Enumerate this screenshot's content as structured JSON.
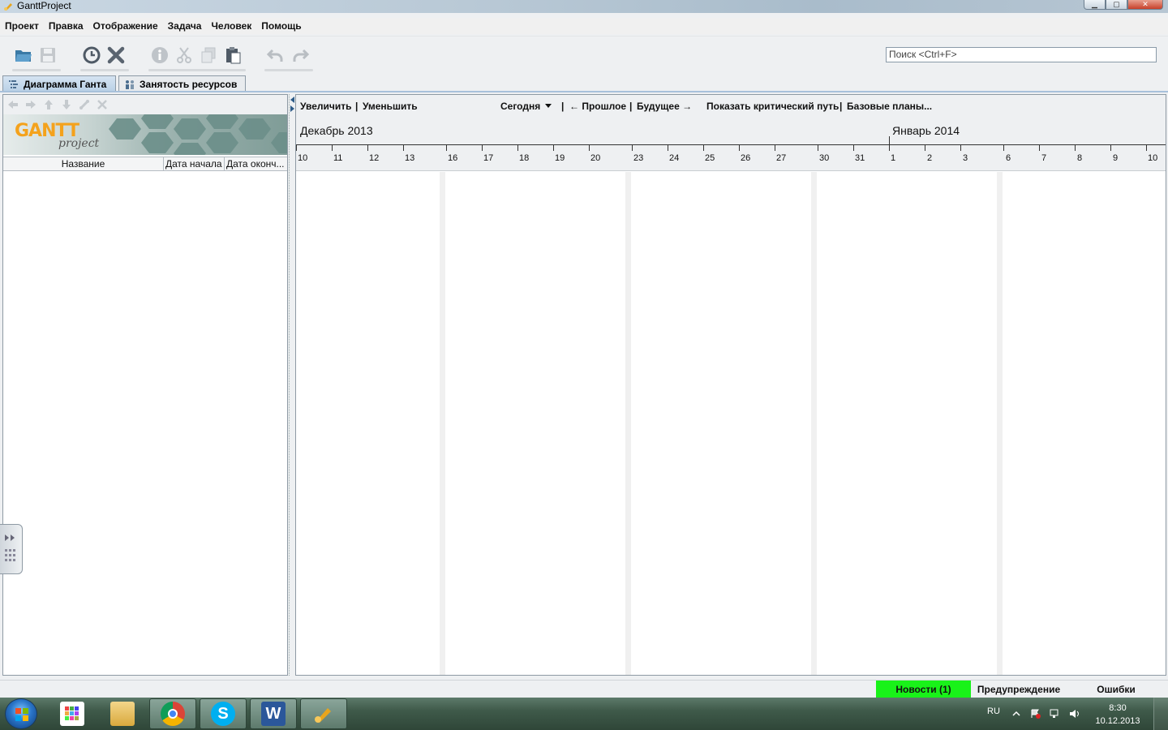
{
  "window": {
    "title": "GanttProject"
  },
  "menu": [
    "Проект",
    "Правка",
    "Отображение",
    "Задача",
    "Человек",
    "Помощь"
  ],
  "toolbar": {
    "icons": [
      "open-folder-icon",
      "save-icon",
      "clock-icon",
      "delete-icon",
      "info-icon",
      "cut-icon",
      "copy-icon",
      "paste-icon",
      "undo-icon",
      "redo-icon"
    ],
    "search_placeholder": "Поиск <Ctrl+F>"
  },
  "tabs": [
    {
      "label": "Диаграмма Ганта",
      "active": true
    },
    {
      "label": "Занятость ресурсов",
      "active": false
    }
  ],
  "left": {
    "banner_logo": "GANTT",
    "banner_sub": "project",
    "columns": {
      "name": "Название",
      "start": "Дата начала",
      "end": "Дата оконч..."
    }
  },
  "chart": {
    "zoom_in": "Увеличить",
    "zoom_out": "Уменьшить",
    "today": "Сегодня",
    "past": "← Прошлое",
    "future": "Будущее →",
    "critical_path": "Показать критический путь",
    "baselines": "Базовые планы...",
    "sep": "|",
    "months": [
      {
        "label": "Декабрь 2013"
      },
      {
        "label": "Январь 2014"
      }
    ],
    "days": [
      "10",
      "11",
      "12",
      "13",
      "16",
      "17",
      "18",
      "19",
      "20",
      "23",
      "24",
      "25",
      "26",
      "27",
      "30",
      "31",
      "1",
      "2",
      "3",
      "6",
      "7",
      "8",
      "9",
      "10"
    ]
  },
  "status": {
    "news": "Новости (1)",
    "warnings": "Предупреждение",
    "errors": "Ошибки"
  },
  "taskbar": {
    "apps": [
      "apps-grid-icon",
      "file-explorer-icon",
      "chrome-icon",
      "skype-icon",
      "word-icon",
      "ganttproject-icon"
    ],
    "lang": "RU",
    "time": "8:30",
    "date": "10.12.2013"
  }
}
